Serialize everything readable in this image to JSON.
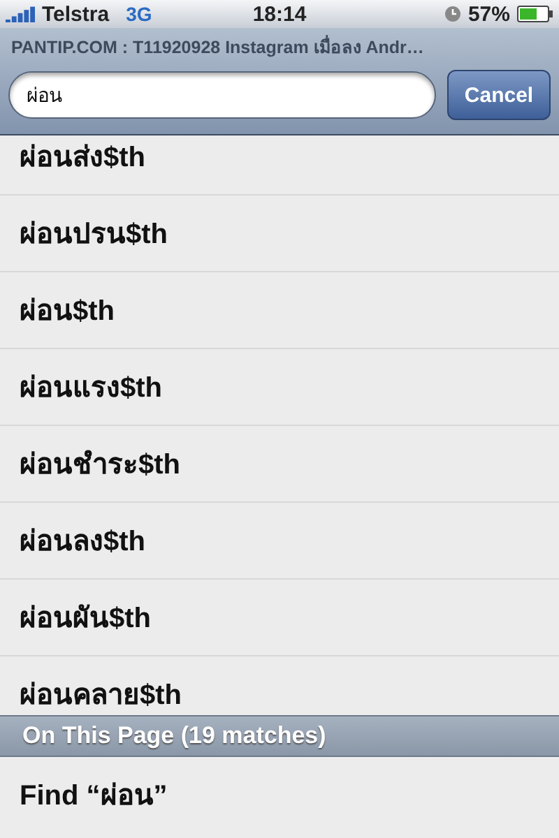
{
  "status_bar": {
    "carrier": "Telstra",
    "network": "3G",
    "time": "18:14",
    "battery": "57%"
  },
  "page_title": "PANTIP.COM : T11920928 Instagram เมื่อลง Andr…",
  "search": {
    "value": "ผ่อน"
  },
  "cancel_button": "Cancel",
  "suggestions": [
    "ผ่อนส่ง$th",
    "ผ่อนปรน$th",
    "ผ่อน$th",
    "ผ่อนแรง$th",
    "ผ่อนชำระ$th",
    "ผ่อนลง$th",
    "ผ่อนผัน$th",
    "ผ่อนคลาย$th"
  ],
  "section_header": "On This Page (19 matches)",
  "find_row": "Find “ผ่อน”"
}
